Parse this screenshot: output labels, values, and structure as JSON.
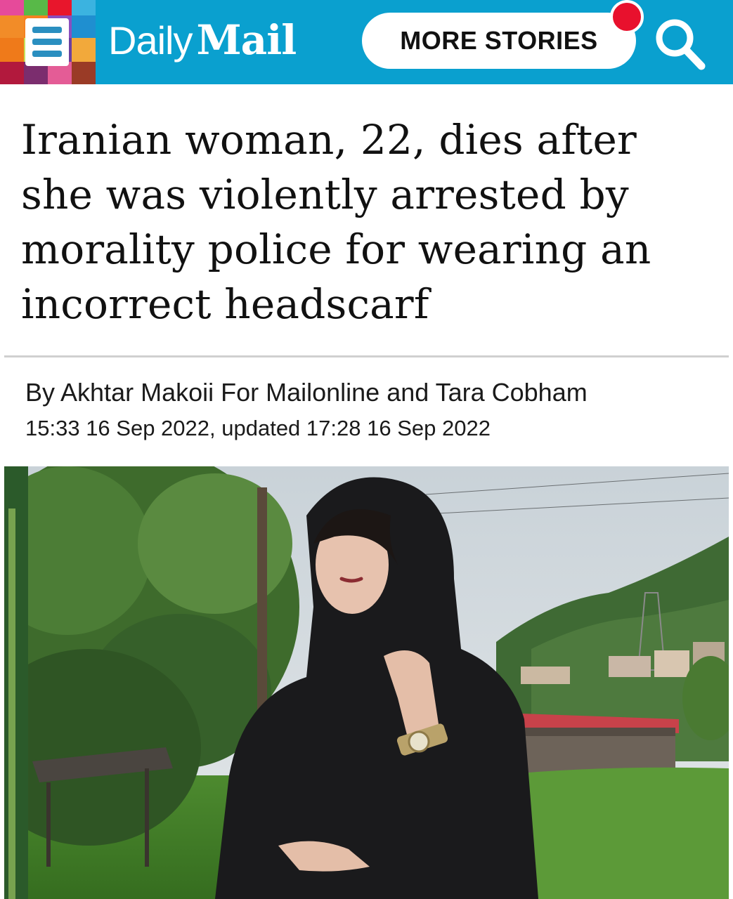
{
  "header": {
    "background_color": "#0aa0cf",
    "logo": {
      "daily": "Daily",
      "mail": "Mail"
    },
    "menu_icon": "hamburger-menu-icon",
    "more_stories_label": "MORE STORIES",
    "notification_color": "#e8112d",
    "search_icon": "search-icon"
  },
  "article": {
    "headline": "Iranian woman, 22, dies after she was violently arrested by morality police for wearing an incorrect headscarf",
    "byline": "By Akhtar Makoii For Mailonline and Tara Cobham",
    "timestamp": "15:33 16 Sep 2022, updated 17:28 16 Sep 2022"
  },
  "photo": {
    "subject": "article-photo"
  }
}
